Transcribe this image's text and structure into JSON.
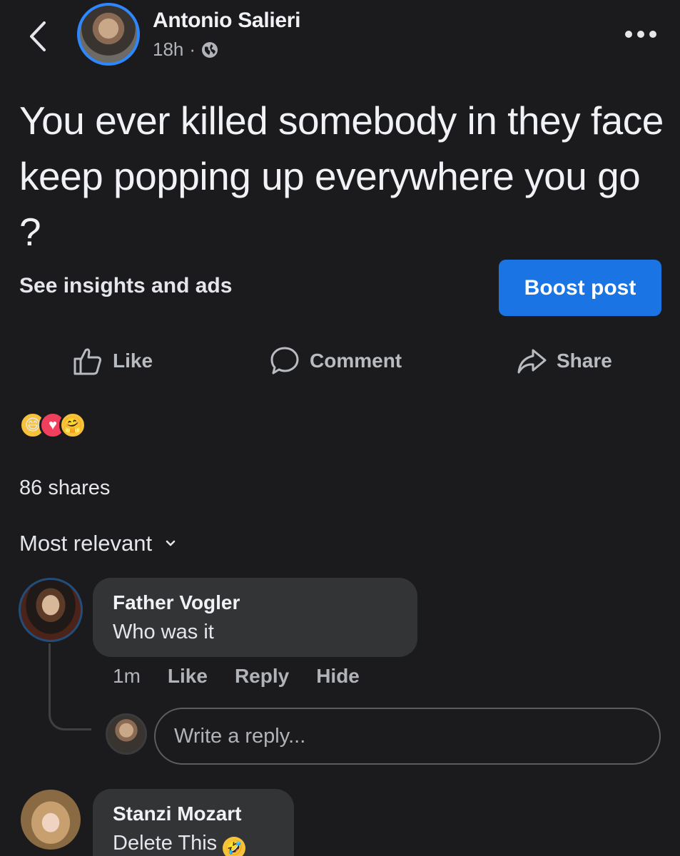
{
  "header": {
    "author_name": "Antonio Salieri",
    "timestamp": "18h",
    "separator": "·",
    "privacy_icon": "globe-icon",
    "more_icon": "more-options-icon"
  },
  "post": {
    "text": "You ever killed somebody in they face keep popping up everywhere you go ?",
    "insights_label": "See insights and ads",
    "boost_label": "Boost post"
  },
  "actions": {
    "like_label": "Like",
    "comment_label": "Comment",
    "share_label": "Share"
  },
  "reactions": [
    "haha",
    "love",
    "care"
  ],
  "shares_count": "86 shares",
  "sort_label": "Most relevant",
  "comments": [
    {
      "author": "Father Vogler",
      "text": "Who was it",
      "time": "1m",
      "actions": [
        "Like",
        "Reply",
        "Hide"
      ]
    },
    {
      "author": "Stanzi Mozart",
      "text": "Delete This",
      "emoji": "rolling-on-floor-laughing"
    }
  ],
  "reply_input": {
    "placeholder": "Write a reply..."
  },
  "colors": {
    "background": "#1b1b1d",
    "accent": "#1b74e4",
    "bubble": "#333436",
    "avatar_ring": "#2d88ff"
  }
}
